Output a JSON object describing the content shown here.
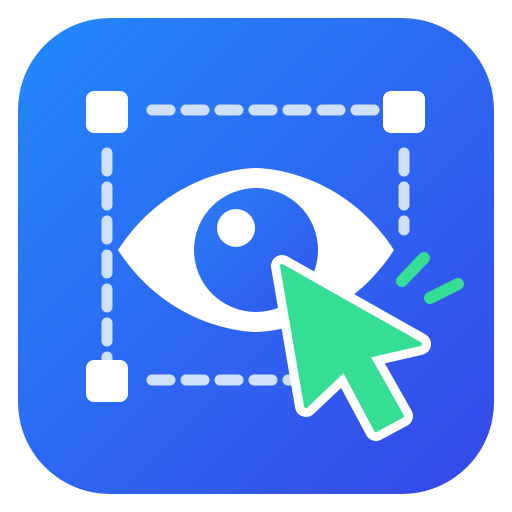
{
  "app_icon": {
    "icons": {
      "background": "rounded-square-icon",
      "selection": "selection-frame-icon",
      "eye": "eye-icon",
      "cursor": "cursor-arrow-icon",
      "click": "click-burst-icon"
    },
    "colors": {
      "gradient_start": "#2389fb",
      "gradient_end": "#3647e9",
      "white": "#ffffff",
      "frame_dash": "#cfe0fb",
      "pupil_start": "#2a7ef6",
      "pupil_end": "#2f55ec",
      "cursor_green": "#36dd94",
      "cursor_outline": "#ffffff"
    }
  }
}
